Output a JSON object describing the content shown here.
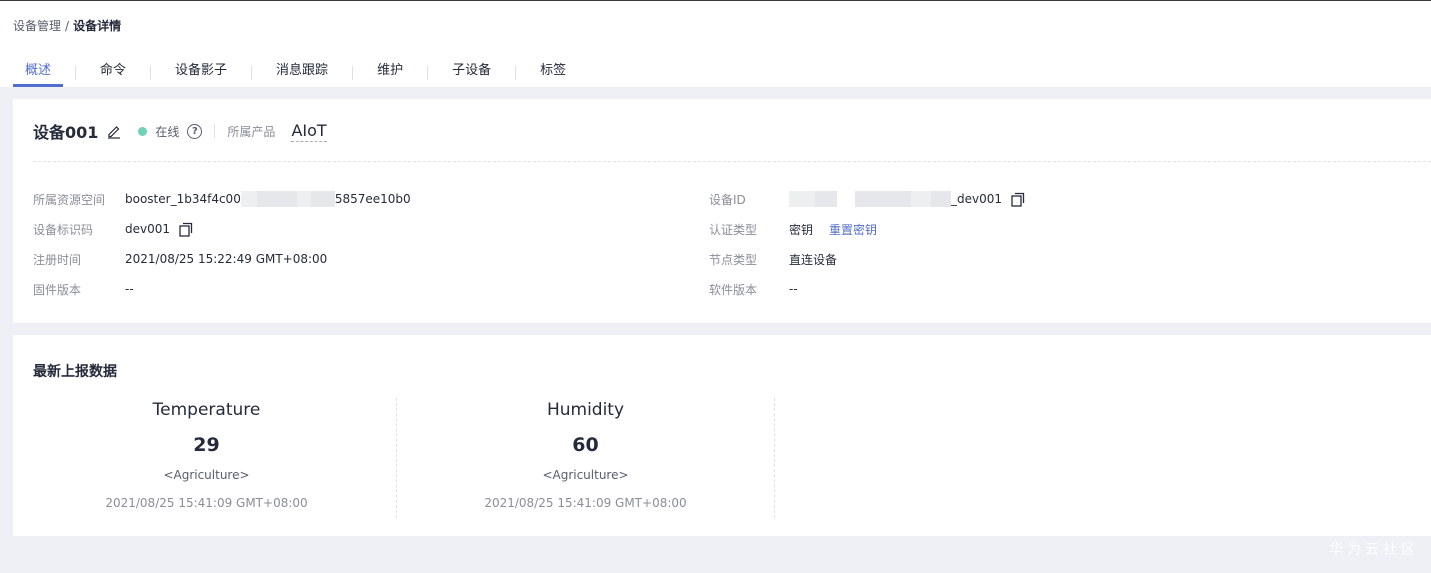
{
  "breadcrumb": {
    "parent": "设备管理",
    "separator": "/",
    "current": "设备详情"
  },
  "tabs": [
    {
      "label": "概述",
      "active": true
    },
    {
      "label": "命令"
    },
    {
      "label": "设备影子"
    },
    {
      "label": "消息跟踪"
    },
    {
      "label": "维护"
    },
    {
      "label": "子设备"
    },
    {
      "label": "标签"
    }
  ],
  "device": {
    "name": "设备001",
    "status": "在线",
    "status_color": "#6fd1b6",
    "product_label": "所属产品",
    "product_value": "AIoT"
  },
  "info": {
    "space_label": "所属资源空间",
    "space_prefix": "booster_1b34f4c00",
    "space_suffix": "5857ee10b0",
    "devcode_label": "设备标识码",
    "devcode_value": "dev001",
    "regtime_label": "注册时间",
    "regtime_value": "2021/08/25 15:22:49 GMT+08:00",
    "fw_label": "固件版本",
    "fw_value": "--",
    "devid_label": "设备ID",
    "devid_suffix": "_dev001",
    "auth_label": "认证类型",
    "auth_value": "密钥",
    "auth_link": "重置密钥",
    "node_label": "节点类型",
    "node_value": "直连设备",
    "sw_label": "软件版本",
    "sw_value": "--"
  },
  "report": {
    "title": "最新上报数据",
    "metrics": [
      {
        "name": "Temperature",
        "value": "29",
        "service": "<Agriculture>",
        "time": "2021/08/25 15:41:09 GMT+08:00"
      },
      {
        "name": "Humidity",
        "value": "60",
        "service": "<Agriculture>",
        "time": "2021/08/25 15:41:09 GMT+08:00"
      }
    ]
  },
  "watermark": "华为云社区",
  "colors": {
    "accent": "#526ecc",
    "online": "#6fd1b6",
    "background": "#eef0f5"
  },
  "icons": [
    "edit-icon",
    "help-icon",
    "copy-icon"
  ]
}
